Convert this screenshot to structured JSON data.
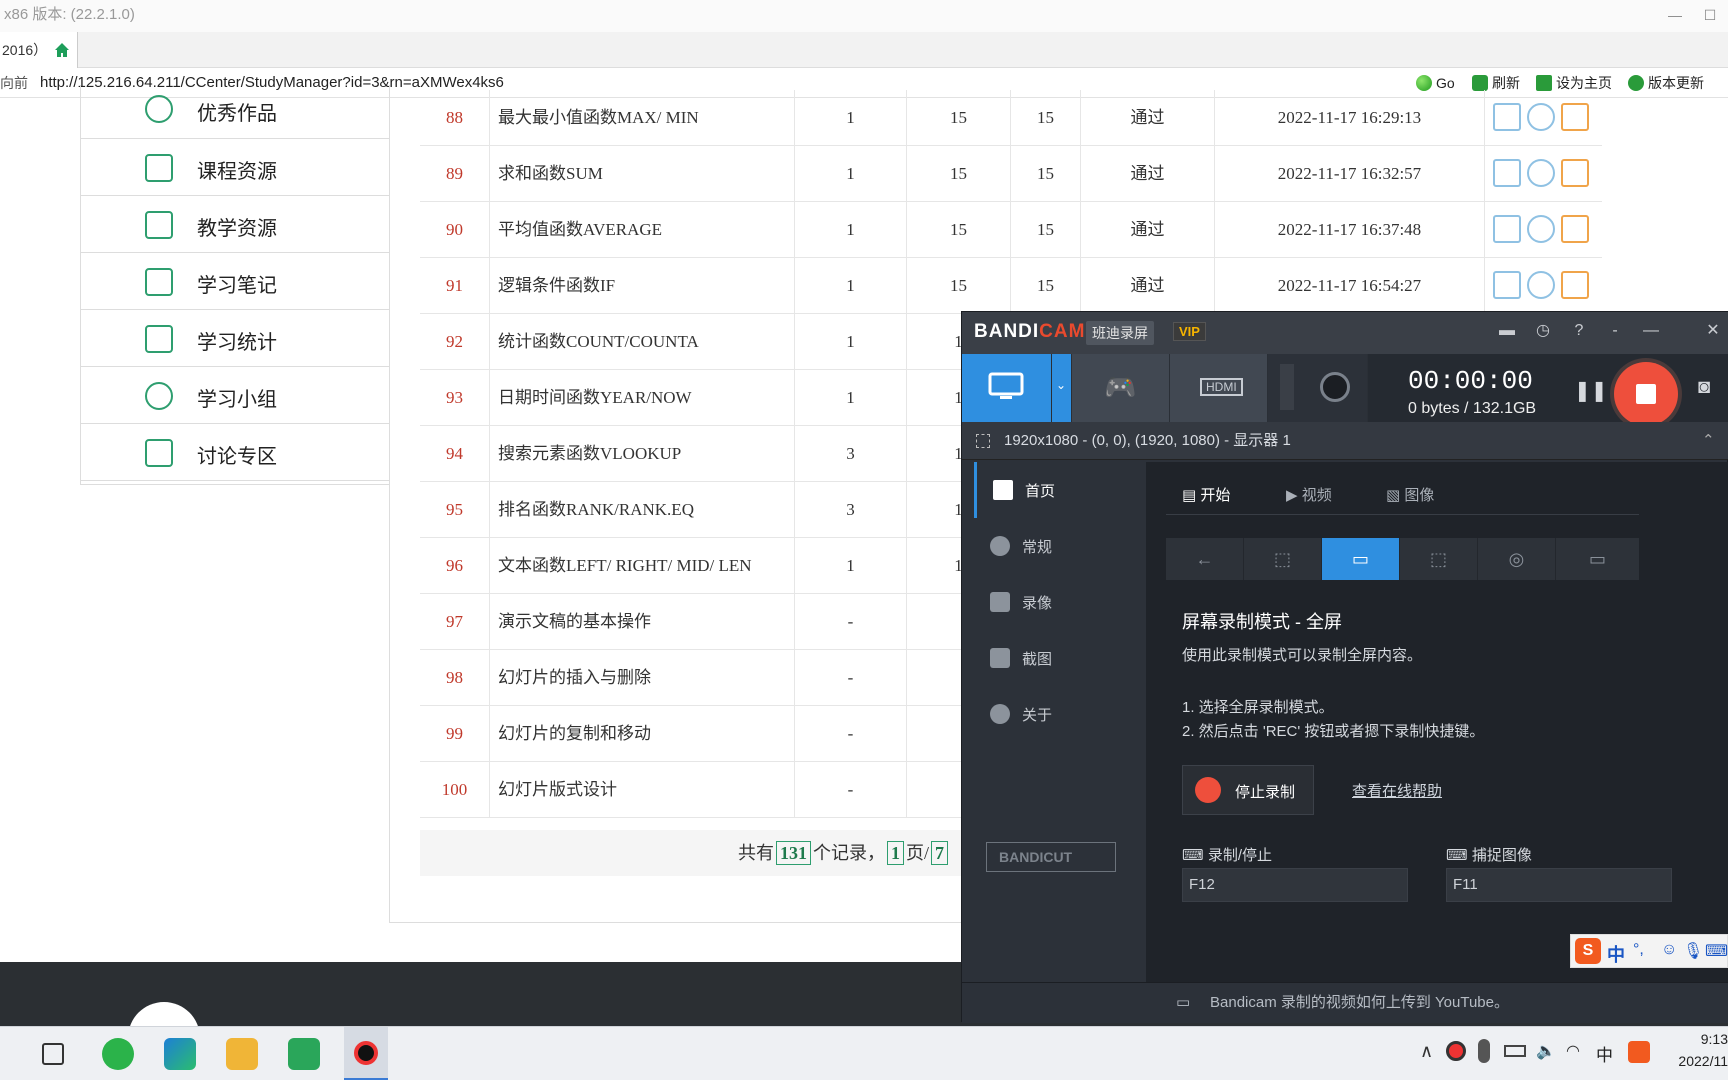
{
  "titlebar": {
    "title": "x86 版本: (22.2.1.0)"
  },
  "tab": {
    "label": "2016）"
  },
  "address": {
    "prefix": "向前",
    "url": "http://125.216.64.211/CCenter/StudyManager?id=3&rn=aXMWex4ks6"
  },
  "nav": {
    "go": "Go",
    "refresh": "刷新",
    "homepage": "设为主页",
    "update": "版本更新"
  },
  "sidebar": {
    "items": [
      {
        "label": "优秀作品",
        "icon": "award-icon"
      },
      {
        "label": "课程资源",
        "icon": "layers-icon"
      },
      {
        "label": "教学资源",
        "icon": "teaching-icon"
      },
      {
        "label": "学习笔记",
        "icon": "note-icon"
      },
      {
        "label": "学习统计",
        "icon": "stats-icon"
      },
      {
        "label": "学习小组",
        "icon": "group-icon"
      },
      {
        "label": "讨论专区",
        "icon": "chat-icon"
      }
    ]
  },
  "table": {
    "rows": [
      {
        "no": "88",
        "name": "最大最小值函数MAX/ MIN",
        "a": "1",
        "b": "15",
        "c": "15",
        "status": "通过",
        "date": "2022-11-17 16:29:13"
      },
      {
        "no": "89",
        "name": "求和函数SUM",
        "a": "1",
        "b": "15",
        "c": "15",
        "status": "通过",
        "date": "2022-11-17 16:32:57"
      },
      {
        "no": "90",
        "name": "平均值函数AVERAGE",
        "a": "1",
        "b": "15",
        "c": "15",
        "status": "通过",
        "date": "2022-11-17 16:37:48"
      },
      {
        "no": "91",
        "name": "逻辑条件函数IF",
        "a": "1",
        "b": "15",
        "c": "15",
        "status": "通过",
        "date": "2022-11-17 16:54:27"
      },
      {
        "no": "92",
        "name": "统计函数COUNT/COUNTA",
        "a": "1",
        "b": "1",
        "c": "",
        "status": "",
        "date": ""
      },
      {
        "no": "93",
        "name": "日期时间函数YEAR/NOW",
        "a": "1",
        "b": "1",
        "c": "",
        "status": "",
        "date": ""
      },
      {
        "no": "94",
        "name": "搜索元素函数VLOOKUP",
        "a": "3",
        "b": "1",
        "c": "",
        "status": "",
        "date": ""
      },
      {
        "no": "95",
        "name": "排名函数RANK/RANK.EQ",
        "a": "3",
        "b": "1",
        "c": "",
        "status": "",
        "date": ""
      },
      {
        "no": "96",
        "name": "文本函数LEFT/ RIGHT/ MID/ LEN",
        "a": "1",
        "b": "1",
        "c": "",
        "status": "",
        "date": ""
      },
      {
        "no": "97",
        "name": "演示文稿的基本操作",
        "a": "-",
        "b": "",
        "c": "",
        "status": "",
        "date": ""
      },
      {
        "no": "98",
        "name": "幻灯片的插入与删除",
        "a": "-",
        "b": "",
        "c": "",
        "status": "",
        "date": ""
      },
      {
        "no": "99",
        "name": "幻灯片的复制和移动",
        "a": "-",
        "b": "",
        "c": "",
        "status": "",
        "date": ""
      },
      {
        "no": "100",
        "name": "幻灯片版式设计",
        "a": "-",
        "b": "",
        "c": "",
        "status": "",
        "date": ""
      }
    ]
  },
  "pager": {
    "prefix": "共有",
    "total": "131",
    "mid": "个记录，",
    "page": "1",
    "sep": "页/",
    "pages": "7"
  },
  "bandicam": {
    "logo_main": "BANDI",
    "logo_accent": "CAM",
    "cn_name": "班迪录屏",
    "vip": "VIP",
    "timer": "00:00:00",
    "size": "0 bytes / 132.1GB",
    "area": "1920x1080 - (0, 0), (1920, 1080) - 显示器 1",
    "nav": [
      "首页",
      "常规",
      "录像",
      "截图",
      "关于"
    ],
    "subtabs": [
      "开始",
      "视频",
      "图像"
    ],
    "mode_title": "屏幕录制模式 - 全屏",
    "mode_desc": "使用此录制模式可以录制全屏内容。",
    "step1": "1. 选择全屏录制模式。",
    "step2": "2. 然后点击 'REC' 按钮或者摁下录制快捷键。",
    "stop_label": "停止录制",
    "help_link": "查看在线帮助",
    "hotkey_rec_label": "录制/停止",
    "hotkey_rec": "F12",
    "hotkey_cap_label": "捕捉图像",
    "hotkey_cap": "F11",
    "bandicut": "BANDICUT",
    "footer": "Bandicam 录制的视频如何上传到 YouTube。",
    "accent": "#2f8fe0",
    "rec_color": "#ee4f3c"
  },
  "ime": {
    "lang": "中",
    "punct": "°,"
  },
  "taskbar": {
    "clock_time": "9:13",
    "clock_date": "2022/11",
    "ime_lang": "中"
  }
}
